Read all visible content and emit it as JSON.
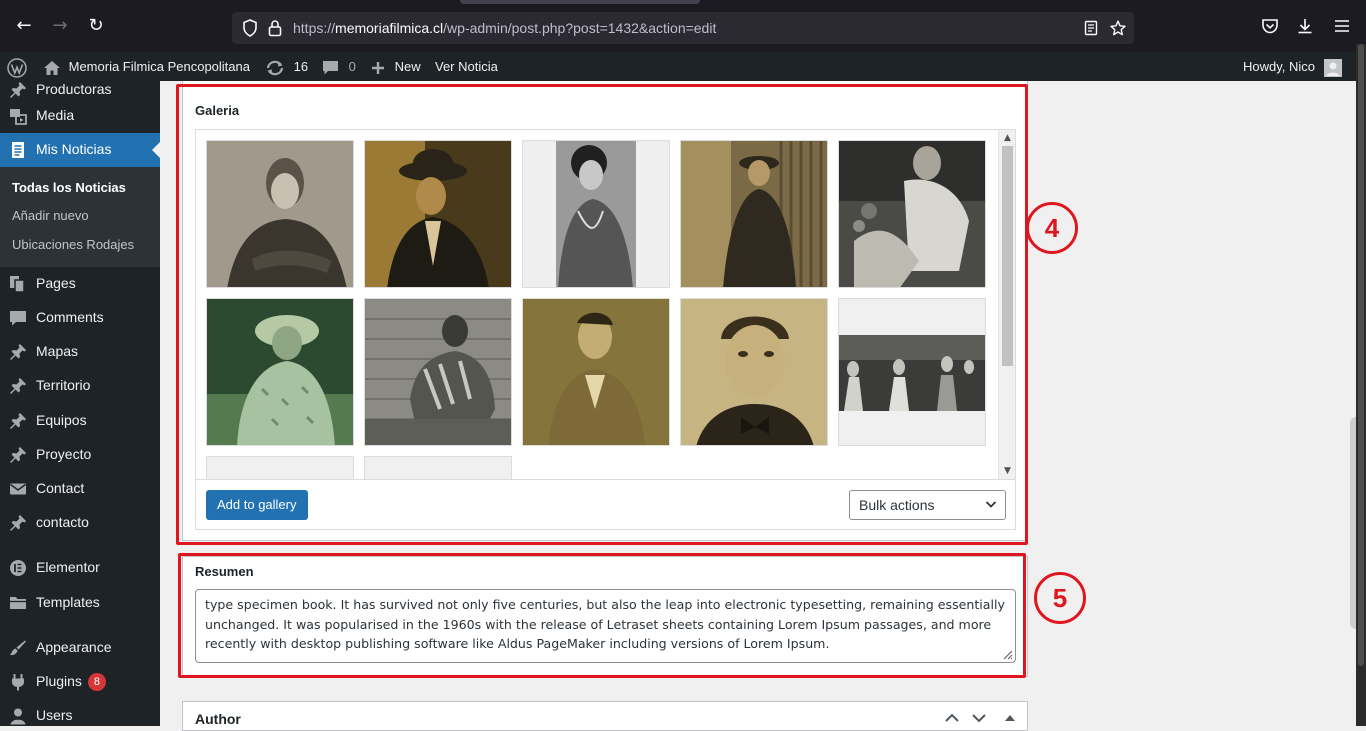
{
  "browser": {
    "url_prefix": "https://",
    "url_domain": "memoriafilmica.cl",
    "url_path": "/wp-admin/post.php?post=1432&action=edit"
  },
  "adminbar": {
    "site_name": "Memoria Filmica Pencopolitana",
    "updates_count": "16",
    "comments_count": "0",
    "new_label": "New",
    "view_label": "Ver Noticia",
    "howdy": "Howdy, Nico"
  },
  "sidebar": {
    "items": [
      {
        "label": "Productoras",
        "icon": "pin-icon"
      },
      {
        "label": "Media",
        "icon": "media-icon"
      },
      {
        "label": "Mis Noticias",
        "icon": "post-icon"
      },
      {
        "label": "Pages",
        "icon": "pages-icon"
      },
      {
        "label": "Comments",
        "icon": "comments-icon"
      },
      {
        "label": "Mapas",
        "icon": "pin-icon"
      },
      {
        "label": "Territorio",
        "icon": "pin-icon"
      },
      {
        "label": "Equipos",
        "icon": "pin-icon"
      },
      {
        "label": "Proyecto",
        "icon": "pin-icon"
      },
      {
        "label": "Contact",
        "icon": "mail-icon"
      },
      {
        "label": "contacto",
        "icon": "pin-icon"
      },
      {
        "label": "Elementor",
        "icon": "elementor-icon"
      },
      {
        "label": "Templates",
        "icon": "folder-icon"
      },
      {
        "label": "Appearance",
        "icon": "brush-icon"
      },
      {
        "label": "Plugins",
        "icon": "plugin-icon",
        "badge": "8"
      },
      {
        "label": "Users",
        "icon": "user-icon"
      }
    ],
    "submenu": [
      "Todas los Noticias",
      "Añadir nuevo",
      "Ubicaciones Rodajes"
    ]
  },
  "gallery": {
    "title": "Galeria",
    "add_label": "Add to gallery",
    "bulk_label": "Bulk actions",
    "annotation": "4"
  },
  "resumen": {
    "title": "Resumen",
    "text": "type specimen book. It has survived not only five centuries, but also the leap into electronic typesetting, remaining essentially unchanged. It was popularised in the 1960s with the release of Letraset sheets containing Lorem Ipsum passages, and more recently with desktop publishing software like Aldus PageMaker including versions of Lorem Ipsum.",
    "annotation": "5"
  },
  "author": {
    "title": "Author"
  },
  "colors": {
    "wp_dark": "#1d2327",
    "wp_blue": "#2271b1",
    "annotation_red": "#e0161f"
  }
}
